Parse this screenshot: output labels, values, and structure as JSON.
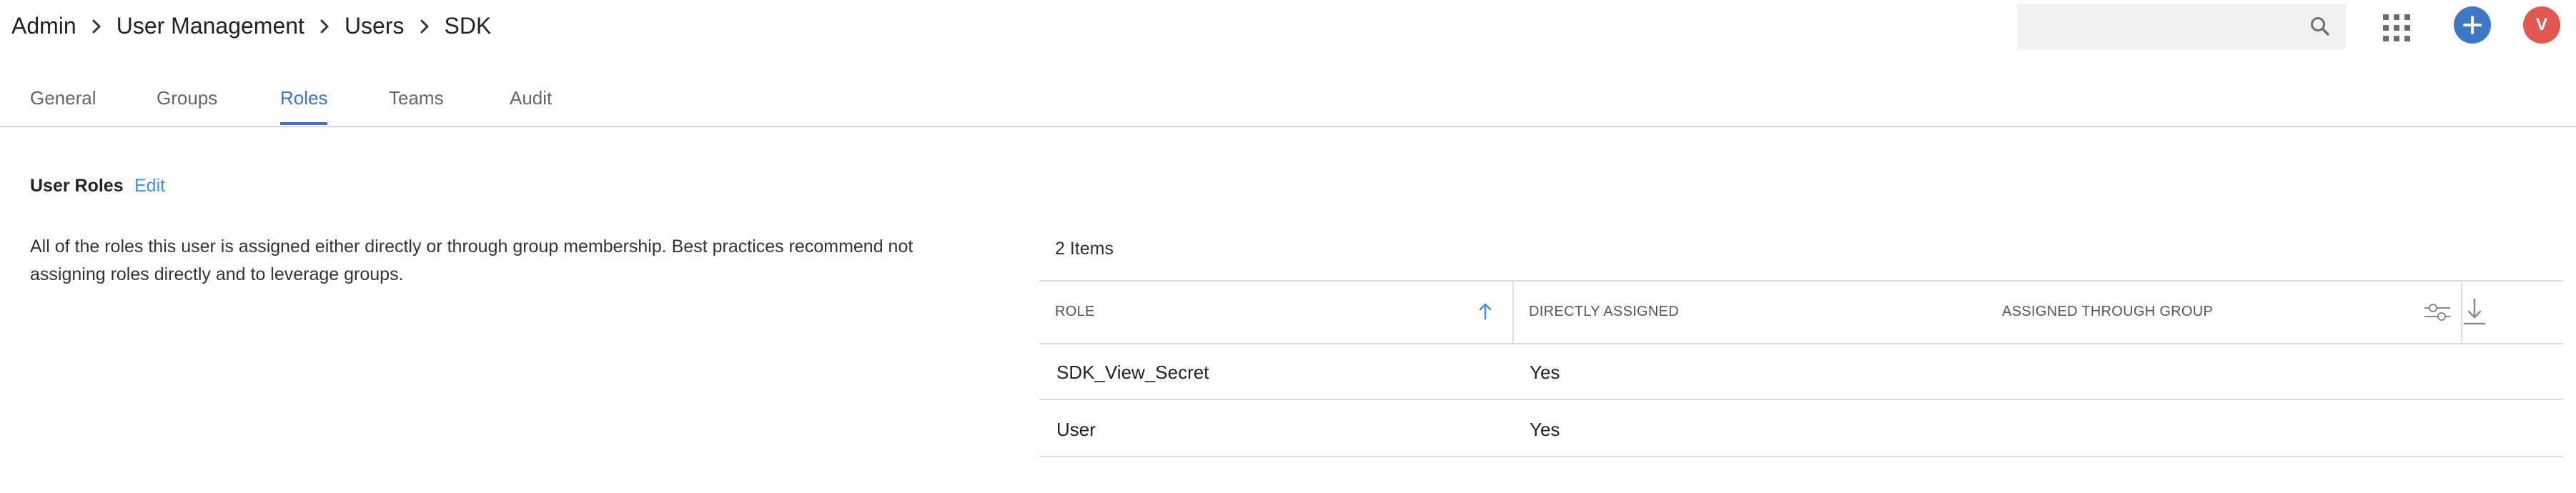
{
  "breadcrumb": {
    "items": [
      "Admin",
      "User Management",
      "Users",
      "SDK"
    ]
  },
  "header": {
    "search_placeholder": "",
    "avatar_initial": "V",
    "colors": {
      "add_button": "#3f78c8",
      "avatar": "#e0584f"
    }
  },
  "tabs": [
    {
      "label": "General"
    },
    {
      "label": "Groups"
    },
    {
      "label": "Roles",
      "active": true
    },
    {
      "label": "Teams"
    },
    {
      "label": "Audit"
    }
  ],
  "section": {
    "title": "User Roles",
    "edit_label": "Edit",
    "description": "All of the roles this user is assigned either directly or through group membership. Best practices recommend not assigning roles directly and to leverage groups."
  },
  "table": {
    "items_count": "2 Items",
    "columns": [
      "ROLE",
      "DIRECTLY ASSIGNED",
      "ASSIGNED THROUGH GROUP"
    ],
    "sort": {
      "column": "ROLE",
      "direction": "ascending"
    },
    "rows": [
      {
        "role": "SDK_View_Secret",
        "directly_assigned": "Yes",
        "through_group": ""
      },
      {
        "role": "User",
        "directly_assigned": "Yes",
        "through_group": ""
      }
    ]
  },
  "icons": [
    "search-icon",
    "apps-grid-icon",
    "plus-icon",
    "sort-ascending-icon",
    "column-settings-icon",
    "download-icon",
    "chevron-right-icon"
  ],
  "colors": {
    "accent": "#3f72c8",
    "link": "#3d8fe0"
  }
}
